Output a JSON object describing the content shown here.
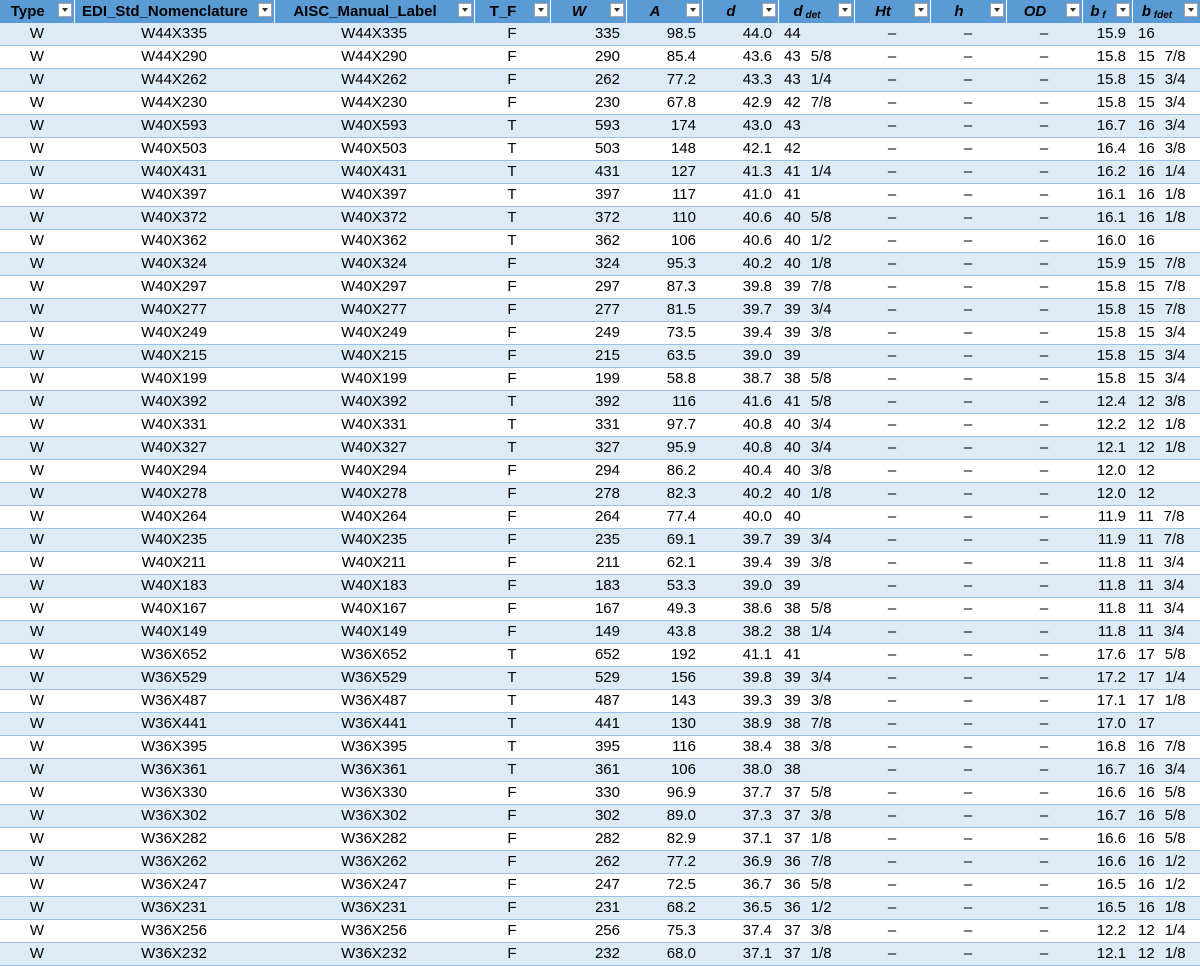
{
  "columns": [
    {
      "key": "type",
      "label": "Type",
      "sub": ""
    },
    {
      "key": "edi",
      "label": "EDI_Std_Nomenclature",
      "sub": ""
    },
    {
      "key": "aisc",
      "label": "AISC_Manual_Label",
      "sub": ""
    },
    {
      "key": "tf",
      "label": "T_F",
      "sub": ""
    },
    {
      "key": "w",
      "label": "W",
      "sub": ""
    },
    {
      "key": "a",
      "label": "A",
      "sub": ""
    },
    {
      "key": "d",
      "label": "d",
      "sub": ""
    },
    {
      "key": "ddet",
      "label": "d",
      "sub": "det"
    },
    {
      "key": "ht",
      "label": "Ht",
      "sub": ""
    },
    {
      "key": "h",
      "label": "h",
      "sub": ""
    },
    {
      "key": "od",
      "label": "OD",
      "sub": ""
    },
    {
      "key": "bf",
      "label": "b",
      "sub": "f"
    },
    {
      "key": "bfdet",
      "label": "b",
      "sub": "fdet"
    }
  ],
  "rows": [
    [
      "W",
      "W44X335",
      "W44X335",
      "F",
      "335",
      "98.5",
      "44.0",
      "44",
      "",
      "–",
      "–",
      "–",
      "15.9",
      "16",
      ""
    ],
    [
      "W",
      "W44X290",
      "W44X290",
      "F",
      "290",
      "85.4",
      "43.6",
      "43",
      "5/8",
      "–",
      "–",
      "–",
      "15.8",
      "15",
      "7/8"
    ],
    [
      "W",
      "W44X262",
      "W44X262",
      "F",
      "262",
      "77.2",
      "43.3",
      "43",
      "1/4",
      "–",
      "–",
      "–",
      "15.8",
      "15",
      "3/4"
    ],
    [
      "W",
      "W44X230",
      "W44X230",
      "F",
      "230",
      "67.8",
      "42.9",
      "42",
      "7/8",
      "–",
      "–",
      "–",
      "15.8",
      "15",
      "3/4"
    ],
    [
      "W",
      "W40X593",
      "W40X593",
      "T",
      "593",
      "174",
      "43.0",
      "43",
      "",
      "–",
      "–",
      "–",
      "16.7",
      "16",
      "3/4"
    ],
    [
      "W",
      "W40X503",
      "W40X503",
      "T",
      "503",
      "148",
      "42.1",
      "42",
      "",
      "–",
      "–",
      "–",
      "16.4",
      "16",
      "3/8"
    ],
    [
      "W",
      "W40X431",
      "W40X431",
      "T",
      "431",
      "127",
      "41.3",
      "41",
      "1/4",
      "–",
      "–",
      "–",
      "16.2",
      "16",
      "1/4"
    ],
    [
      "W",
      "W40X397",
      "W40X397",
      "T",
      "397",
      "117",
      "41.0",
      "41",
      "",
      "–",
      "–",
      "–",
      "16.1",
      "16",
      "1/8"
    ],
    [
      "W",
      "W40X372",
      "W40X372",
      "T",
      "372",
      "110",
      "40.6",
      "40",
      "5/8",
      "–",
      "–",
      "–",
      "16.1",
      "16",
      "1/8"
    ],
    [
      "W",
      "W40X362",
      "W40X362",
      "T",
      "362",
      "106",
      "40.6",
      "40",
      "1/2",
      "–",
      "–",
      "–",
      "16.0",
      "16",
      ""
    ],
    [
      "W",
      "W40X324",
      "W40X324",
      "F",
      "324",
      "95.3",
      "40.2",
      "40",
      "1/8",
      "–",
      "–",
      "–",
      "15.9",
      "15",
      "7/8"
    ],
    [
      "W",
      "W40X297",
      "W40X297",
      "F",
      "297",
      "87.3",
      "39.8",
      "39",
      "7/8",
      "–",
      "–",
      "–",
      "15.8",
      "15",
      "7/8"
    ],
    [
      "W",
      "W40X277",
      "W40X277",
      "F",
      "277",
      "81.5",
      "39.7",
      "39",
      "3/4",
      "–",
      "–",
      "–",
      "15.8",
      "15",
      "7/8"
    ],
    [
      "W",
      "W40X249",
      "W40X249",
      "F",
      "249",
      "73.5",
      "39.4",
      "39",
      "3/8",
      "–",
      "–",
      "–",
      "15.8",
      "15",
      "3/4"
    ],
    [
      "W",
      "W40X215",
      "W40X215",
      "F",
      "215",
      "63.5",
      "39.0",
      "39",
      "",
      "–",
      "–",
      "–",
      "15.8",
      "15",
      "3/4"
    ],
    [
      "W",
      "W40X199",
      "W40X199",
      "F",
      "199",
      "58.8",
      "38.7",
      "38",
      "5/8",
      "–",
      "–",
      "–",
      "15.8",
      "15",
      "3/4"
    ],
    [
      "W",
      "W40X392",
      "W40X392",
      "T",
      "392",
      "116",
      "41.6",
      "41",
      "5/8",
      "–",
      "–",
      "–",
      "12.4",
      "12",
      "3/8"
    ],
    [
      "W",
      "W40X331",
      "W40X331",
      "T",
      "331",
      "97.7",
      "40.8",
      "40",
      "3/4",
      "–",
      "–",
      "–",
      "12.2",
      "12",
      "1/8"
    ],
    [
      "W",
      "W40X327",
      "W40X327",
      "T",
      "327",
      "95.9",
      "40.8",
      "40",
      "3/4",
      "–",
      "–",
      "–",
      "12.1",
      "12",
      "1/8"
    ],
    [
      "W",
      "W40X294",
      "W40X294",
      "F",
      "294",
      "86.2",
      "40.4",
      "40",
      "3/8",
      "–",
      "–",
      "–",
      "12.0",
      "12",
      ""
    ],
    [
      "W",
      "W40X278",
      "W40X278",
      "F",
      "278",
      "82.3",
      "40.2",
      "40",
      "1/8",
      "–",
      "–",
      "–",
      "12.0",
      "12",
      ""
    ],
    [
      "W",
      "W40X264",
      "W40X264",
      "F",
      "264",
      "77.4",
      "40.0",
      "40",
      "",
      "–",
      "–",
      "–",
      "11.9",
      "11",
      "7/8"
    ],
    [
      "W",
      "W40X235",
      "W40X235",
      "F",
      "235",
      "69.1",
      "39.7",
      "39",
      "3/4",
      "–",
      "–",
      "–",
      "11.9",
      "11",
      "7/8"
    ],
    [
      "W",
      "W40X211",
      "W40X211",
      "F",
      "211",
      "62.1",
      "39.4",
      "39",
      "3/8",
      "–",
      "–",
      "–",
      "11.8",
      "11",
      "3/4"
    ],
    [
      "W",
      "W40X183",
      "W40X183",
      "F",
      "183",
      "53.3",
      "39.0",
      "39",
      "",
      "–",
      "–",
      "–",
      "11.8",
      "11",
      "3/4"
    ],
    [
      "W",
      "W40X167",
      "W40X167",
      "F",
      "167",
      "49.3",
      "38.6",
      "38",
      "5/8",
      "–",
      "–",
      "–",
      "11.8",
      "11",
      "3/4"
    ],
    [
      "W",
      "W40X149",
      "W40X149",
      "F",
      "149",
      "43.8",
      "38.2",
      "38",
      "1/4",
      "–",
      "–",
      "–",
      "11.8",
      "11",
      "3/4"
    ],
    [
      "W",
      "W36X652",
      "W36X652",
      "T",
      "652",
      "192",
      "41.1",
      "41",
      "",
      "–",
      "–",
      "–",
      "17.6",
      "17",
      "5/8"
    ],
    [
      "W",
      "W36X529",
      "W36X529",
      "T",
      "529",
      "156",
      "39.8",
      "39",
      "3/4",
      "–",
      "–",
      "–",
      "17.2",
      "17",
      "1/4"
    ],
    [
      "W",
      "W36X487",
      "W36X487",
      "T",
      "487",
      "143",
      "39.3",
      "39",
      "3/8",
      "–",
      "–",
      "–",
      "17.1",
      "17",
      "1/8"
    ],
    [
      "W",
      "W36X441",
      "W36X441",
      "T",
      "441",
      "130",
      "38.9",
      "38",
      "7/8",
      "–",
      "–",
      "–",
      "17.0",
      "17",
      ""
    ],
    [
      "W",
      "W36X395",
      "W36X395",
      "T",
      "395",
      "116",
      "38.4",
      "38",
      "3/8",
      "–",
      "–",
      "–",
      "16.8",
      "16",
      "7/8"
    ],
    [
      "W",
      "W36X361",
      "W36X361",
      "T",
      "361",
      "106",
      "38.0",
      "38",
      "",
      "–",
      "–",
      "–",
      "16.7",
      "16",
      "3/4"
    ],
    [
      "W",
      "W36X330",
      "W36X330",
      "F",
      "330",
      "96.9",
      "37.7",
      "37",
      "5/8",
      "–",
      "–",
      "–",
      "16.6",
      "16",
      "5/8"
    ],
    [
      "W",
      "W36X302",
      "W36X302",
      "F",
      "302",
      "89.0",
      "37.3",
      "37",
      "3/8",
      "–",
      "–",
      "–",
      "16.7",
      "16",
      "5/8"
    ],
    [
      "W",
      "W36X282",
      "W36X282",
      "F",
      "282",
      "82.9",
      "37.1",
      "37",
      "1/8",
      "–",
      "–",
      "–",
      "16.6",
      "16",
      "5/8"
    ],
    [
      "W",
      "W36X262",
      "W36X262",
      "F",
      "262",
      "77.2",
      "36.9",
      "36",
      "7/8",
      "–",
      "–",
      "–",
      "16.6",
      "16",
      "1/2"
    ],
    [
      "W",
      "W36X247",
      "W36X247",
      "F",
      "247",
      "72.5",
      "36.7",
      "36",
      "5/8",
      "–",
      "–",
      "–",
      "16.5",
      "16",
      "1/2"
    ],
    [
      "W",
      "W36X231",
      "W36X231",
      "F",
      "231",
      "68.2",
      "36.5",
      "36",
      "1/2",
      "–",
      "–",
      "–",
      "16.5",
      "16",
      "1/8"
    ],
    [
      "W",
      "W36X256",
      "W36X256",
      "F",
      "256",
      "75.3",
      "37.4",
      "37",
      "3/8",
      "–",
      "–",
      "–",
      "12.2",
      "12",
      "1/4"
    ],
    [
      "W",
      "W36X232",
      "W36X232",
      "F",
      "232",
      "68.0",
      "37.1",
      "37",
      "1/8",
      "–",
      "–",
      "–",
      "12.1",
      "12",
      "1/8"
    ]
  ]
}
